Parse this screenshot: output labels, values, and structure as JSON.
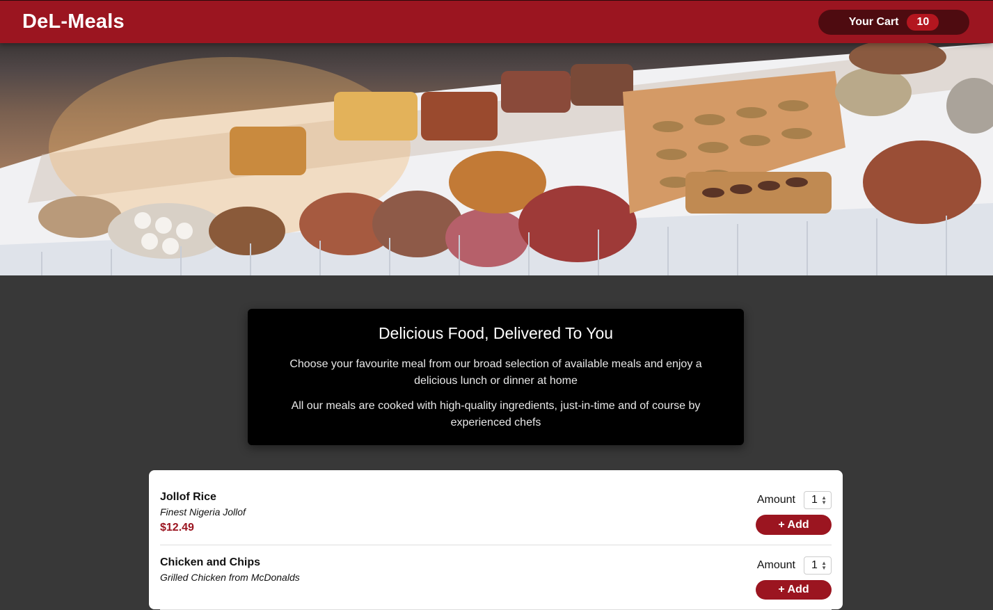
{
  "header": {
    "brand": "DeL-Meals",
    "cart_label": "Your Cart",
    "cart_count": "10"
  },
  "summary": {
    "title": "Delicious Food, Delivered To You",
    "paragraph1": "Choose your favourite meal from our broad selection of available meals and enjoy a delicious lunch or dinner at home",
    "paragraph2": "All our meals are cooked with high-quality ingredients, just-in-time and of course by experienced chefs"
  },
  "meals": [
    {
      "name": "Jollof Rice",
      "description": "Finest Nigeria Jollof",
      "price": "$12.49",
      "amount_label": "Amount",
      "amount_value": "1",
      "add_label": "+ Add"
    },
    {
      "name": "Chicken and Chips",
      "description": "Grilled Chicken from McDonalds",
      "price": "",
      "amount_label": "Amount",
      "amount_value": "1",
      "add_label": "+ Add"
    }
  ],
  "colors": {
    "brand_red": "#9b1520",
    "cart_bg": "#4e0b10",
    "page_bg": "#383838"
  }
}
